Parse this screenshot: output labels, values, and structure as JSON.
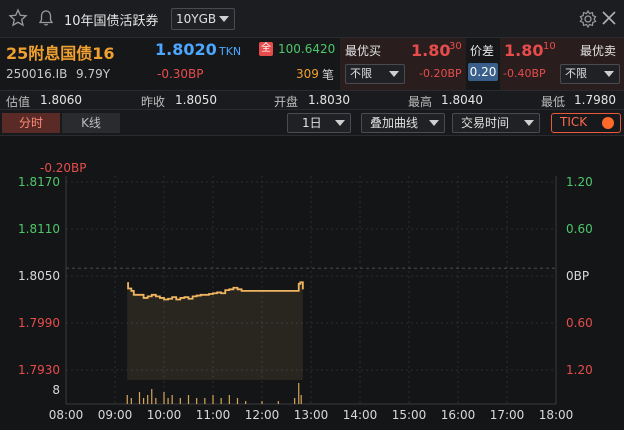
{
  "header": {
    "title": "10年国债活跃券",
    "selector_value": "10YGB"
  },
  "quote": {
    "bond_name": "25附息国债16",
    "price": "1.8020",
    "price_source": "TKN",
    "full_tag": "全",
    "full_price": "100.6420",
    "code": "250016.IB",
    "tenor": "9.79Y",
    "change_bp": "-0.30BP",
    "volume_count": "309",
    "volume_unit": "笔",
    "best_bid_label": "最优买",
    "bid_price": "1.80",
    "bid_superscript": "30",
    "bid_filter": "不限",
    "bid_bp": "-0.20BP",
    "spread_label": "价差",
    "spread_value": "0.20",
    "ask_price": "1.80",
    "ask_superscript": "10",
    "ask_filter": "不限",
    "ask_bp": "-0.40BP",
    "best_ask_label": "最优卖"
  },
  "stats": {
    "valuation_label": "估值",
    "valuation": "1.8060",
    "prev_close_label": "昨收",
    "prev_close": "1.8050",
    "open_label": "开盘",
    "open": "1.8030",
    "high_label": "最高",
    "high": "1.8040",
    "low_label": "最低",
    "low": "1.7980"
  },
  "toolbar": {
    "tab_intraday": "分时",
    "tab_kline": "K线",
    "period": "1日",
    "overlay": "叠加曲线",
    "trading_time": "交易时间",
    "tick_label": "TICK"
  },
  "colors": {
    "up": "#e74c4c",
    "down": "#4ec76a",
    "accent": "#f0a030",
    "price_blue": "#4da6ff"
  },
  "chart_data": {
    "type": "line",
    "change_annotation": "-0.20BP",
    "y_left_ticks": [
      "1.8170",
      "1.8110",
      "1.8050",
      "1.7990",
      "1.7930"
    ],
    "y_right_ticks": [
      "1.20",
      "0.60",
      "0BP",
      "0.60",
      "1.20"
    ],
    "ylim": [
      1.793,
      1.817
    ],
    "volume_tick": "8",
    "x_ticks": [
      "08:00",
      "09:00",
      "10:00",
      "11:00",
      "12:00",
      "13:00",
      "14:00",
      "15:00",
      "16:00",
      "17:00",
      "18:00"
    ],
    "x_start_min": 480,
    "x_end_min": 1080,
    "series": [
      {
        "points": [
          [
            "09:15",
            1.8041
          ],
          [
            "09:16",
            1.8034
          ],
          [
            "09:20",
            1.8031
          ],
          [
            "09:23",
            1.8026
          ],
          [
            "09:30",
            1.8026
          ],
          [
            "09:35",
            1.8022
          ],
          [
            "09:40",
            1.8024
          ],
          [
            "09:45",
            1.8026
          ],
          [
            "09:50",
            1.8024
          ],
          [
            "09:55",
            1.8022
          ],
          [
            "10:00",
            1.802
          ],
          [
            "10:05",
            1.8021
          ],
          [
            "10:10",
            1.8023
          ],
          [
            "10:15",
            1.802
          ],
          [
            "10:20",
            1.8022
          ],
          [
            "10:25",
            1.8023
          ],
          [
            "10:30",
            1.8021
          ],
          [
            "10:35",
            1.8024
          ],
          [
            "10:40",
            1.8025
          ],
          [
            "10:45",
            1.8026
          ],
          [
            "10:50",
            1.8026
          ],
          [
            "10:55",
            1.8027
          ],
          [
            "11:00",
            1.8028
          ],
          [
            "11:05",
            1.8029
          ],
          [
            "11:10",
            1.8028
          ],
          [
            "11:15",
            1.8032
          ],
          [
            "11:20",
            1.8033
          ],
          [
            "11:25",
            1.8035
          ],
          [
            "11:30",
            1.8033
          ],
          [
            "11:35",
            1.8031
          ],
          [
            "11:40",
            1.8031
          ],
          [
            "11:50",
            1.8031
          ],
          [
            "12:00",
            1.8031
          ],
          [
            "12:10",
            1.8031
          ],
          [
            "12:20",
            1.8031
          ],
          [
            "12:30",
            1.8031
          ],
          [
            "12:40",
            1.8031
          ],
          [
            "12:45",
            1.804
          ],
          [
            "12:47",
            1.8042
          ],
          [
            "12:50",
            1.8033
          ]
        ]
      }
    ],
    "volume": [
      [
        "09:15",
        3
      ],
      [
        "09:20",
        2
      ],
      [
        "09:30",
        4
      ],
      [
        "09:35",
        2
      ],
      [
        "09:40",
        3
      ],
      [
        "09:45",
        5
      ],
      [
        "09:50",
        2
      ],
      [
        "10:00",
        4
      ],
      [
        "10:05",
        2
      ],
      [
        "10:10",
        3
      ],
      [
        "10:20",
        2
      ],
      [
        "10:30",
        3
      ],
      [
        "10:40",
        2
      ],
      [
        "10:50",
        2
      ],
      [
        "11:00",
        3
      ],
      [
        "11:10",
        2
      ],
      [
        "11:20",
        3
      ],
      [
        "11:30",
        2
      ],
      [
        "11:40",
        1
      ],
      [
        "12:00",
        1
      ],
      [
        "12:20",
        1
      ],
      [
        "12:40",
        2
      ],
      [
        "12:45",
        7
      ],
      [
        "12:48",
        3
      ]
    ]
  }
}
